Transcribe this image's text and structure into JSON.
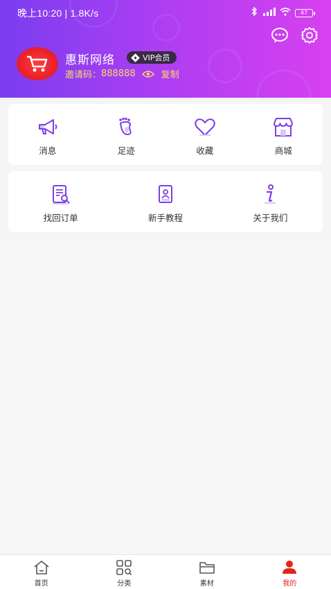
{
  "status_bar": {
    "time": "晚上10:20 | 1.8K/s",
    "battery": "47"
  },
  "profile": {
    "username": "惠斯网络",
    "vip_label": "VIP会员",
    "invite_label": "邀请码：",
    "invite_code": "888888",
    "copy_label": "复制"
  },
  "shortcuts": [
    {
      "label": "消息",
      "icon": "megaphone-icon"
    },
    {
      "label": "足迹",
      "icon": "footprint-icon"
    },
    {
      "label": "收藏",
      "icon": "heart-icon"
    },
    {
      "label": "商城",
      "icon": "shop-icon"
    }
  ],
  "services": [
    {
      "label": "找回订单",
      "icon": "order-search-icon"
    },
    {
      "label": "新手教程",
      "icon": "tutorial-icon"
    },
    {
      "label": "关于我们",
      "icon": "info-icon"
    }
  ],
  "tabs": [
    {
      "label": "首页",
      "icon": "home-icon"
    },
    {
      "label": "分类",
      "icon": "category-icon"
    },
    {
      "label": "素材",
      "icon": "folder-icon"
    },
    {
      "label": "我的",
      "icon": "user-icon",
      "active": true
    }
  ],
  "colors": {
    "header_start": "#7b3df0",
    "header_end": "#d740f0",
    "icon_purple": "#7c3ee8",
    "accent_yellow": "#ffd76a",
    "active_red": "#e2231a"
  }
}
